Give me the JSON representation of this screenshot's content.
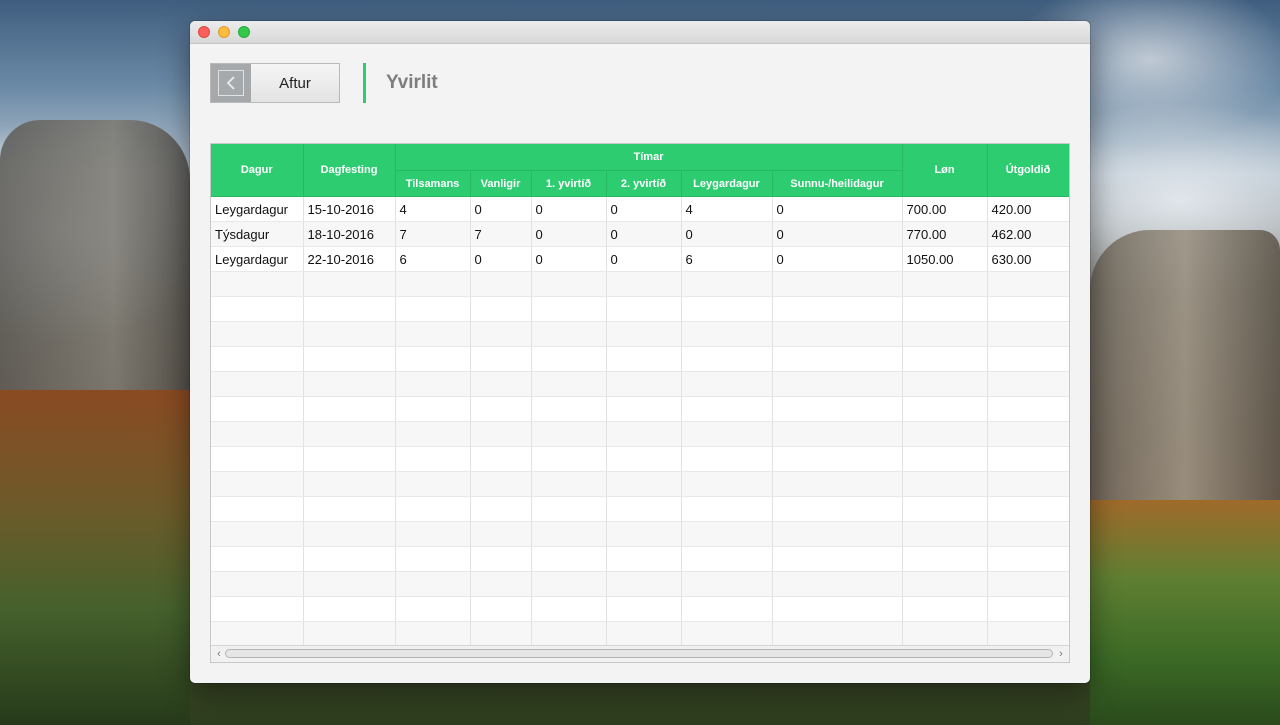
{
  "window": {
    "title": ""
  },
  "toolbar": {
    "back_label": "Aftur",
    "page_title": "Yvirlit"
  },
  "table": {
    "columns": [
      "Dagur",
      "Dagfesting",
      "Tilsamans",
      "Vanligir",
      "1. yvirtíð",
      "2. yvirtíð",
      "Leygardagur",
      "Sunnu-/heilidagur",
      "Løn",
      "Útgoldið"
    ],
    "group_header": "Tímar",
    "rows": [
      [
        "Leygardagur",
        "15-10-2016",
        "4",
        "0",
        "0",
        "0",
        "4",
        "0",
        "700.00",
        "420.00"
      ],
      [
        "Týsdagur",
        "18-10-2016",
        "7",
        "7",
        "0",
        "0",
        "0",
        "0",
        "770.00",
        "462.00"
      ],
      [
        "Leygardagur",
        "22-10-2016",
        "6",
        "0",
        "0",
        "0",
        "6",
        "0",
        "1050.00",
        "630.00"
      ]
    ],
    "empty_row_count": 15
  },
  "icons": {
    "back": "chevron-left-icon",
    "scroll_left": "arrow-left-icon",
    "scroll_right": "arrow-right-icon"
  },
  "colors": {
    "header_green": "#2ecc71",
    "title_gray": "#7d7d7d"
  }
}
